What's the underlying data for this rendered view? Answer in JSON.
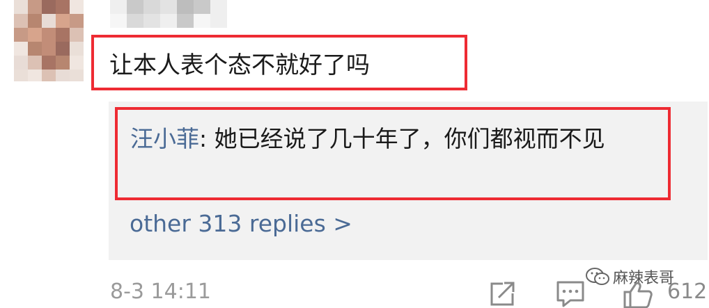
{
  "comment": {
    "text": "让本人表个态不就好了吗",
    "timestamp": "8-3 14:11",
    "like_count": "612"
  },
  "reply": {
    "author": "汪小菲",
    "separator": ": ",
    "text": "她已经说了几十年了，你们都视而不见"
  },
  "more_replies": "other 313 replies >",
  "watermark": "麻辣表哥",
  "colors": {
    "highlight_border": "#ee2b33",
    "link": "#4a6a95",
    "reply_background": "#f2f2f2"
  },
  "icons": [
    "share-icon",
    "comment-icon",
    "thumbs-up-icon",
    "wechat-icon"
  ]
}
